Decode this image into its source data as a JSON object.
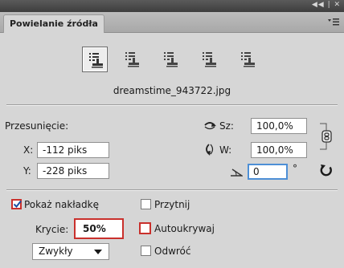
{
  "window": {
    "controls": "◀◀ | ✕",
    "tab_label": "Powielanie źródła"
  },
  "sources": {
    "count": 5,
    "selected_index": 0
  },
  "file": {
    "name": "dreamstime_943722.jpg"
  },
  "offset": {
    "label": "Przesunięcie:",
    "x_label": "X:",
    "x_value": "-112 piks",
    "y_label": "Y:",
    "y_value": "-228 piks"
  },
  "scale": {
    "width_label": "Sz:",
    "width_value": "100,0%",
    "height_label": "W:",
    "height_value": "100,0%",
    "angle_value": "0",
    "angle_unit": "°"
  },
  "overlay": {
    "show_label": "Pokaż nakładkę",
    "show_checked": true,
    "clip_label": "Przytnij",
    "clip_checked": false,
    "opacity_label": "Krycie:",
    "opacity_value": "50%",
    "autohide_label": "Autoukrywaj",
    "autohide_checked": false,
    "mode_value": "Zwykły",
    "invert_label": "Odwróć",
    "invert_checked": false
  },
  "colors": {
    "highlight": "#c9302c",
    "focus": "#4d8fd6",
    "panel_bg": "#d6d6d6"
  },
  "icons": {
    "source_slot": "clone-stamp-source-icon",
    "flip_h": "flip-horizontal-icon",
    "flip_v": "flip-vertical-icon",
    "link": "link-chain-icon",
    "angle": "angle-icon",
    "reset": "reset-transform-icon",
    "menu": "panel-menu-icon"
  }
}
